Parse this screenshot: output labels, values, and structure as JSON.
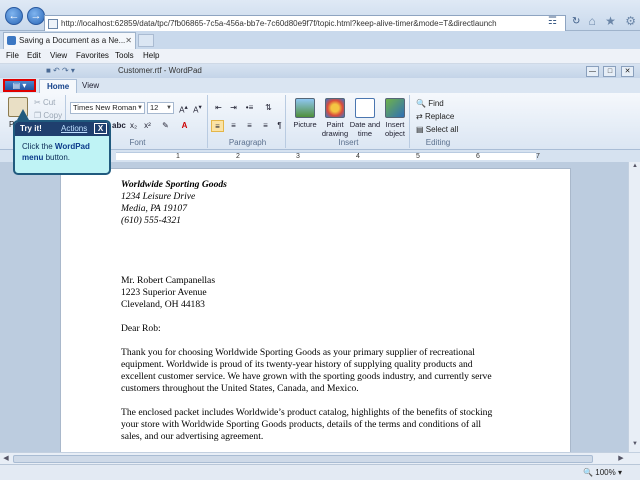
{
  "browser": {
    "url": "http://localhost:62859/data/tpc/7fb06865-7c5a-456a-bb7e-7c60d80e9f7f/topic.html?keep-alive-timer&mode=T&directlaunch",
    "tab_title": "Saving a Document as a Ne...",
    "menu": [
      "File",
      "Edit",
      "View",
      "Favorites",
      "Tools",
      "Help"
    ],
    "zoom": "100%"
  },
  "wordpad": {
    "title": "Customer.rtf - WordPad",
    "tabs": [
      "Home",
      "View"
    ],
    "clipboard": {
      "cut": "Cut",
      "copy": "Copy",
      "paste_short": "P"
    },
    "font": {
      "family": "Times New Roman",
      "size": "12",
      "label": "Font"
    },
    "paragraph_label": "Paragraph",
    "insert": {
      "label": "Insert",
      "picture": "Picture",
      "paint_1": "Paint",
      "paint_2": "drawing",
      "date_1": "Date and",
      "date_2": "time",
      "object_1": "Insert",
      "object_2": "object"
    },
    "editing": {
      "label": "Editing",
      "find": "Find",
      "replace": "Replace",
      "select_all": "Select all"
    },
    "ruler_numbers": [
      "1",
      "2",
      "3",
      "4",
      "5",
      "6",
      "7"
    ]
  },
  "document": {
    "company": "Worldwide Sporting Goods",
    "addr1": "1234 Leisure Drive",
    "addr2": "Media, PA 19107",
    "phone": "(610) 555-4321",
    "recipient_name": "Mr. Robert Campanellas",
    "recipient_addr1": "1223 Superior Avenue",
    "recipient_addr2": "Cleveland, OH  44183",
    "salutation": "Dear Rob:",
    "p1": [
      "Thank you for choosing Worldwide Sporting Goods as your primary supplier of recreational",
      "equipment. Worldwide is proud of its twenty-year history of supplying quality products and",
      "excellent customer service. We have grown with the sporting goods industry, and currently serve",
      "customers throughout the United States, Canada, and Mexico."
    ],
    "p2": [
      "The enclosed packet includes Worldwide’s product catalog, highlights of the benefits of stocking",
      "your store with Worldwide Sporting Goods products, details of the terms and conditions of all",
      "sales, and our advertising agreement."
    ]
  },
  "callout": {
    "title": "Try it!",
    "actions": "Actions",
    "close": "X",
    "text_1": "Click the ",
    "text_bold": "WordPad menu",
    "text_2": " button."
  }
}
